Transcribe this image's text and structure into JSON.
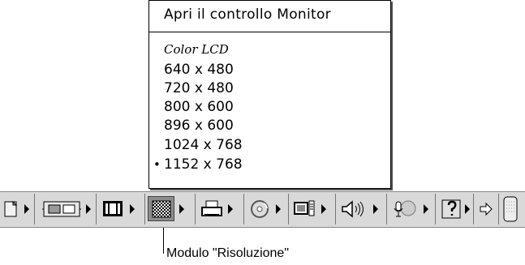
{
  "menu": {
    "header": "Apri il controllo Monitor",
    "display_name": "Color LCD",
    "resolutions": [
      "640 x 480",
      "720 x 480",
      "800 x 600",
      "896 x 600",
      "1024 x 768",
      "1152 x 768"
    ],
    "selected_mark": "•"
  },
  "strip": {
    "modules": [
      {
        "icon": "file-sharing-icon"
      },
      {
        "icon": "network-chip-icon"
      },
      {
        "icon": "monitor-icon"
      },
      {
        "icon": "resolution-checkerboard-icon",
        "selected": true
      },
      {
        "icon": "printer-icon"
      },
      {
        "icon": "cd-icon"
      },
      {
        "icon": "remote-access-icon"
      },
      {
        "icon": "sound-volume-icon"
      },
      {
        "icon": "sound-source-icon"
      },
      {
        "icon": "speech-icon"
      },
      {
        "icon": "web-sharing-icon"
      }
    ]
  },
  "caption": "Modulo \"Risoluzione\""
}
